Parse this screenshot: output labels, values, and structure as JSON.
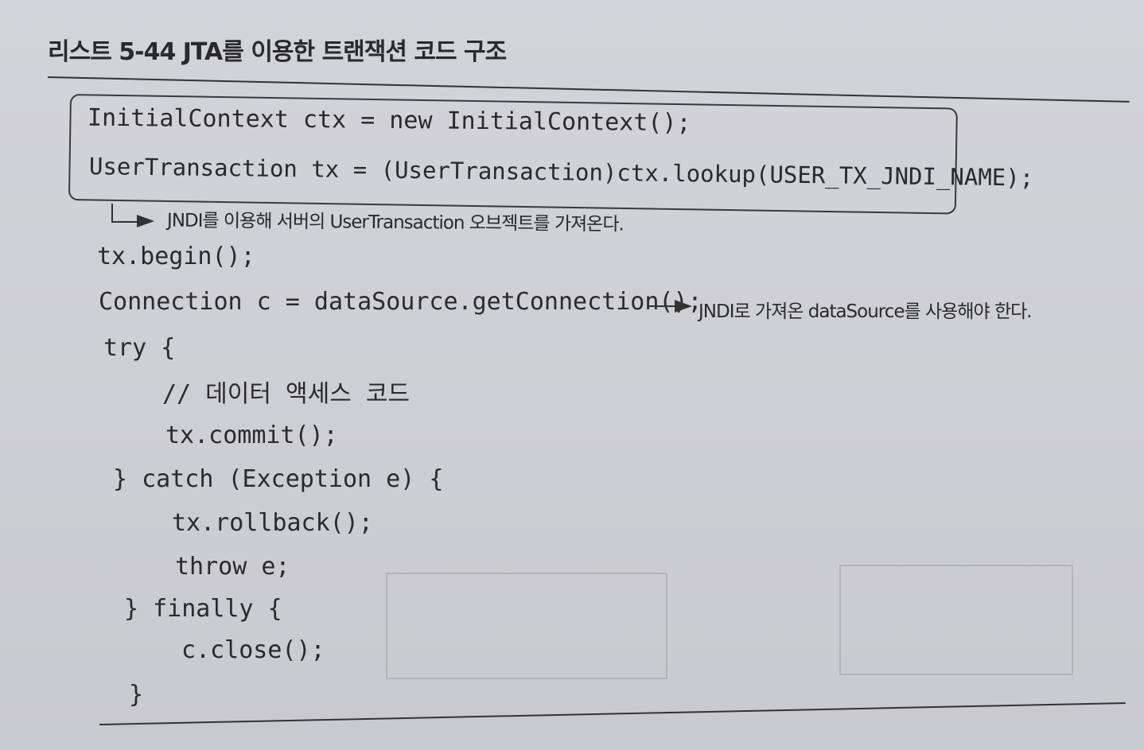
{
  "listing": {
    "title": "리스트 5-44 JTA를 이용한 트랜잭션 코드 구조"
  },
  "code": {
    "box_line1": "InitialContext ctx = new InitialContext();",
    "box_line2": "UserTransaction tx = (UserTransaction)ctx.lookup(USER_TX_JNDI_NAME);",
    "line_begin": "tx.begin();",
    "line_conn": "Connection c = dataSource.getConnection();",
    "line_try": "try {",
    "line_comment": "// 데이터 액세스 코드",
    "line_commit": "tx.commit();",
    "line_catch": "} catch (Exception e) {",
    "line_rollback": "tx.rollback();",
    "line_throw": "throw e;",
    "line_finally": "} finally {",
    "line_close": "c.close();",
    "line_end": "}"
  },
  "notes": {
    "jndi_lookup": "JNDI를 이용해 서버의 UserTransaction 오브젝트를 가져온다.",
    "datasource": "JNDI로 가져온 dataSource를 사용해야 한다."
  }
}
